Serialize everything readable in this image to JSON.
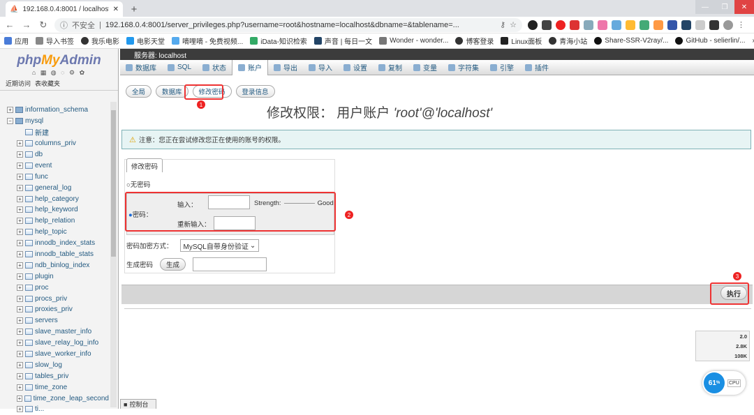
{
  "browser": {
    "tab_title": "192.168.0.4:8001 / localhost | ",
    "address": {
      "insecure": "不安全",
      "host": "192.168.0.4",
      "url": "192.168.0.4:8001/server_privileges.php?username=root&hostname=localhost&dbname=&tablename=..."
    },
    "bookmarks": [
      "应用",
      "导入书签",
      "我乐电影",
      "电影天堂",
      "嘀哩嘀 - 免费视频...",
      "iData-知识检索",
      "声音 | 每日一文",
      "Wonder - wonder...",
      "博客登录",
      "Linux面板",
      "青海小站",
      "Share-SSR-V2ray/...",
      "GitHub - selierlin/..."
    ],
    "more": "»"
  },
  "pma": {
    "logo_php": "php",
    "logo_my": "My",
    "logo_admin": "Admin",
    "logo_icons": "⌂ ▦ ◍ ◌ ⚙ ✿",
    "recent": "近期访问",
    "favorites": "表收藏夹",
    "tree": [
      {
        "name": "information_schema",
        "level": 1,
        "expanded": false
      },
      {
        "name": "mysql",
        "level": 1,
        "expanded": true
      },
      {
        "name": "新建",
        "level": 2,
        "new": true
      },
      {
        "name": "columns_priv",
        "level": 2
      },
      {
        "name": "db",
        "level": 2
      },
      {
        "name": "event",
        "level": 2
      },
      {
        "name": "func",
        "level": 2
      },
      {
        "name": "general_log",
        "level": 2
      },
      {
        "name": "help_category",
        "level": 2
      },
      {
        "name": "help_keyword",
        "level": 2
      },
      {
        "name": "help_relation",
        "level": 2
      },
      {
        "name": "help_topic",
        "level": 2
      },
      {
        "name": "innodb_index_stats",
        "level": 2
      },
      {
        "name": "innodb_table_stats",
        "level": 2
      },
      {
        "name": "ndb_binlog_index",
        "level": 2
      },
      {
        "name": "plugin",
        "level": 2
      },
      {
        "name": "proc",
        "level": 2
      },
      {
        "name": "procs_priv",
        "level": 2
      },
      {
        "name": "proxies_priv",
        "level": 2
      },
      {
        "name": "servers",
        "level": 2
      },
      {
        "name": "slave_master_info",
        "level": 2
      },
      {
        "name": "slave_relay_log_info",
        "level": 2
      },
      {
        "name": "slave_worker_info",
        "level": 2
      },
      {
        "name": "slow_log",
        "level": 2
      },
      {
        "name": "tables_priv",
        "level": 2
      },
      {
        "name": "time_zone",
        "level": 2
      },
      {
        "name": "time_zone_leap_second",
        "level": 2
      },
      {
        "name": "ti...",
        "level": 2
      }
    ],
    "server_bar": "服务器: localhost",
    "main_tabs": [
      "数据库",
      "SQL",
      "状态",
      "账户",
      "导出",
      "导入",
      "设置",
      "复制",
      "变量",
      "字符集",
      "引擎",
      "插件"
    ],
    "active_main_tab": "账户",
    "sub_tabs": [
      "全局",
      "数据库",
      "修改密码",
      "登录信息"
    ],
    "active_sub_tab": "修改密码",
    "title_prefix": "修改权限：",
    "title_user": "用户账户",
    "title_quoted": "'root'@'localhost'",
    "notice": "注意：您正在尝试修改您正在使用的账号的权限。",
    "legend": "修改密码",
    "no_password": "无密码",
    "password_label": "密码：",
    "enter_label": "输入：",
    "strength_label": "Strength:",
    "strength_value": "Good",
    "reenter_label": "重新输入：",
    "encryption_label": "密码加密方式：",
    "encryption_value": "MySQL自带身份验证",
    "generate_label": "生成密码",
    "generate_button": "生成",
    "execute_button": "执行",
    "console": "控制台"
  },
  "annotations": [
    "1",
    "2",
    "3"
  ],
  "widget": {
    "up": "2.0",
    "mid": "2.8K",
    "down": "108K",
    "cpu": "61",
    "cpu_unit": "%",
    "cpu_label": "CPU"
  }
}
